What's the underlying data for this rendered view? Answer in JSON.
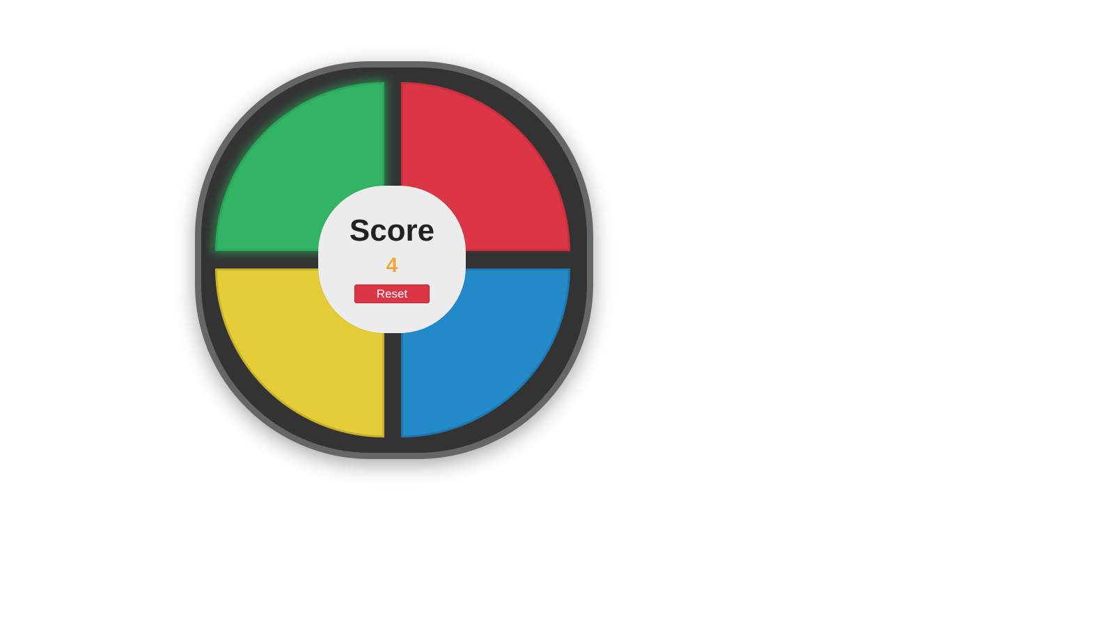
{
  "game": {
    "pads": {
      "green": {
        "color": "#32b464",
        "lit": true
      },
      "red": {
        "color": "#dc3545",
        "lit": false
      },
      "yellow": {
        "color": "#e4cd36",
        "lit": false
      },
      "blue": {
        "color": "#228ac8",
        "lit": false
      }
    },
    "colors": {
      "board": "#333333",
      "rim": "#666666",
      "center": "#ececec",
      "score_value": "#f2a640"
    },
    "center": {
      "title": "Score",
      "score": "4",
      "reset_label": "Reset"
    }
  }
}
